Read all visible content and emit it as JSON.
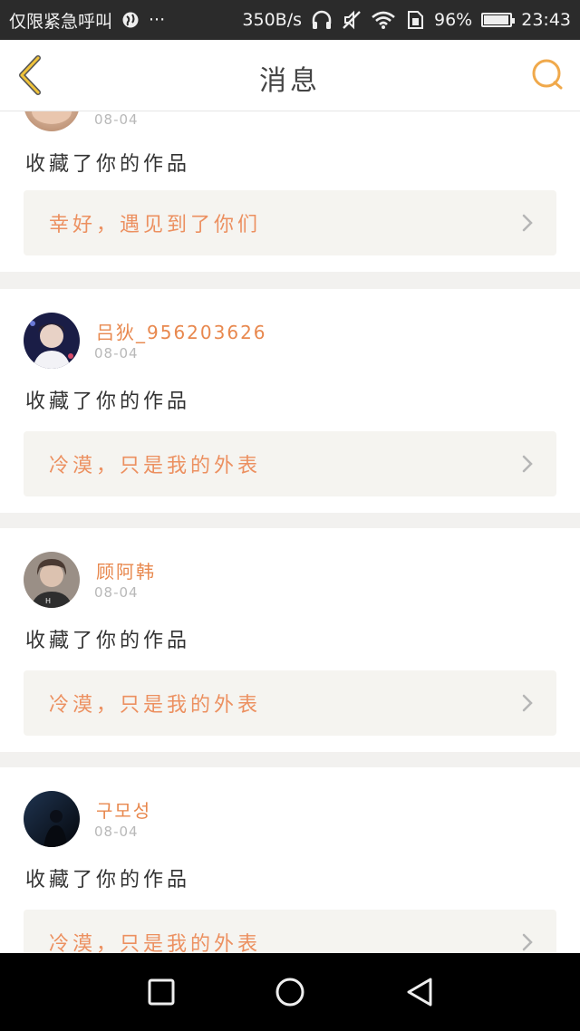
{
  "status_bar": {
    "carrier": "仅限紧急呼叫",
    "dots": "···",
    "speed": "350B/s",
    "battery_percent": "96%",
    "battery_level": 0.96,
    "time": "23:43"
  },
  "header": {
    "title": "消息",
    "back_icon": "chevron-left-icon",
    "search_icon": "search-icon",
    "accent": "#f0a94b"
  },
  "notifications": [
    {
      "username": "",
      "date": "08-04",
      "action": "收藏了你的作品",
      "work_title": "幸好，遇见到了你们"
    },
    {
      "username": "吕狄_956203626",
      "date": "08-04",
      "action": "收藏了你的作品",
      "work_title": "冷漠，只是我的外表"
    },
    {
      "username": "顾阿韩",
      "date": "08-04",
      "action": "收藏了你的作品",
      "work_title": "冷漠，只是我的外表"
    },
    {
      "username": "구모성",
      "date": "08-04",
      "action": "收藏了你的作品",
      "work_title": "冷漠，只是我的外表"
    }
  ],
  "nav_bar": {
    "recent_icon": "square-icon",
    "home_icon": "circle-icon",
    "back_icon": "triangle-back-icon"
  },
  "colors": {
    "username": "#e8884e",
    "work_title": "#ec9060",
    "work_box": "#f5f4f0",
    "separator": "#f2f1ef"
  }
}
